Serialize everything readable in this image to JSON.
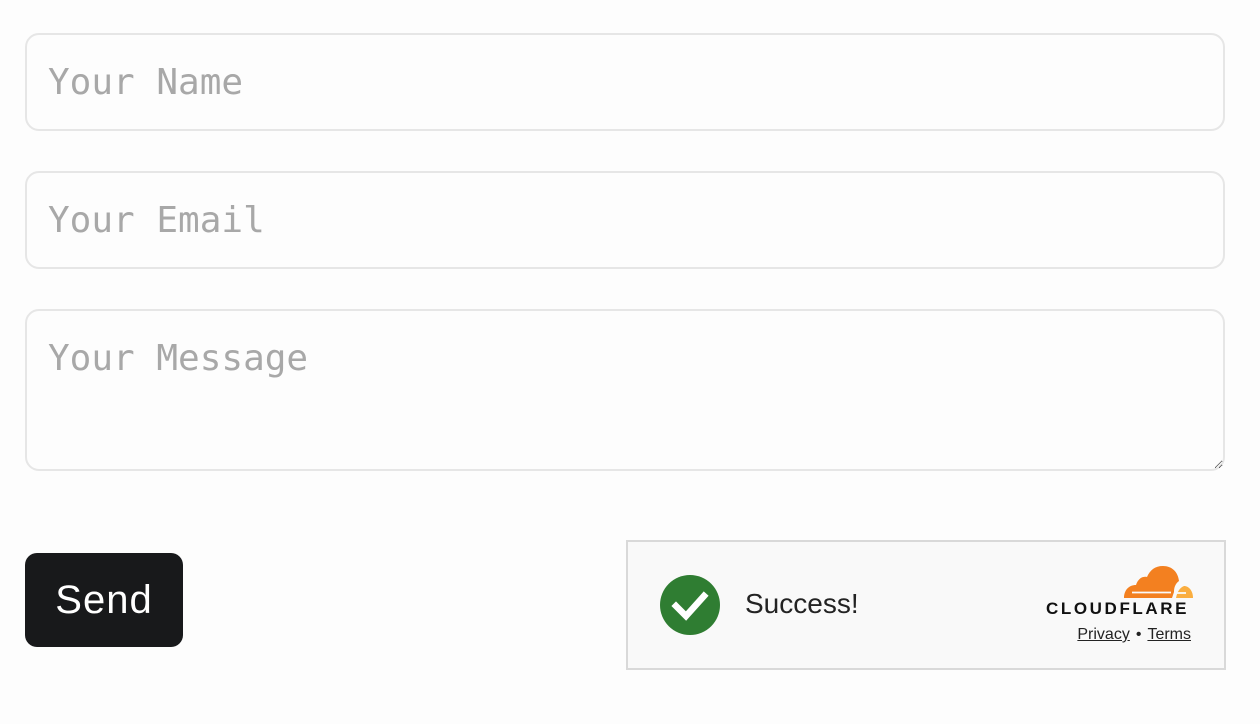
{
  "form": {
    "name_placeholder": "Your Name",
    "email_placeholder": "Your Email",
    "message_placeholder": "Your Message",
    "send_label": "Send"
  },
  "turnstile": {
    "status_text": "Success!",
    "status_icon": "check-circle-icon",
    "status_color": "#2f7d32",
    "logo_text": "CLOUDFLARE",
    "logo_colors": [
      "#f38020",
      "#faae40"
    ],
    "privacy_label": "Privacy",
    "separator": "•",
    "terms_label": "Terms"
  }
}
